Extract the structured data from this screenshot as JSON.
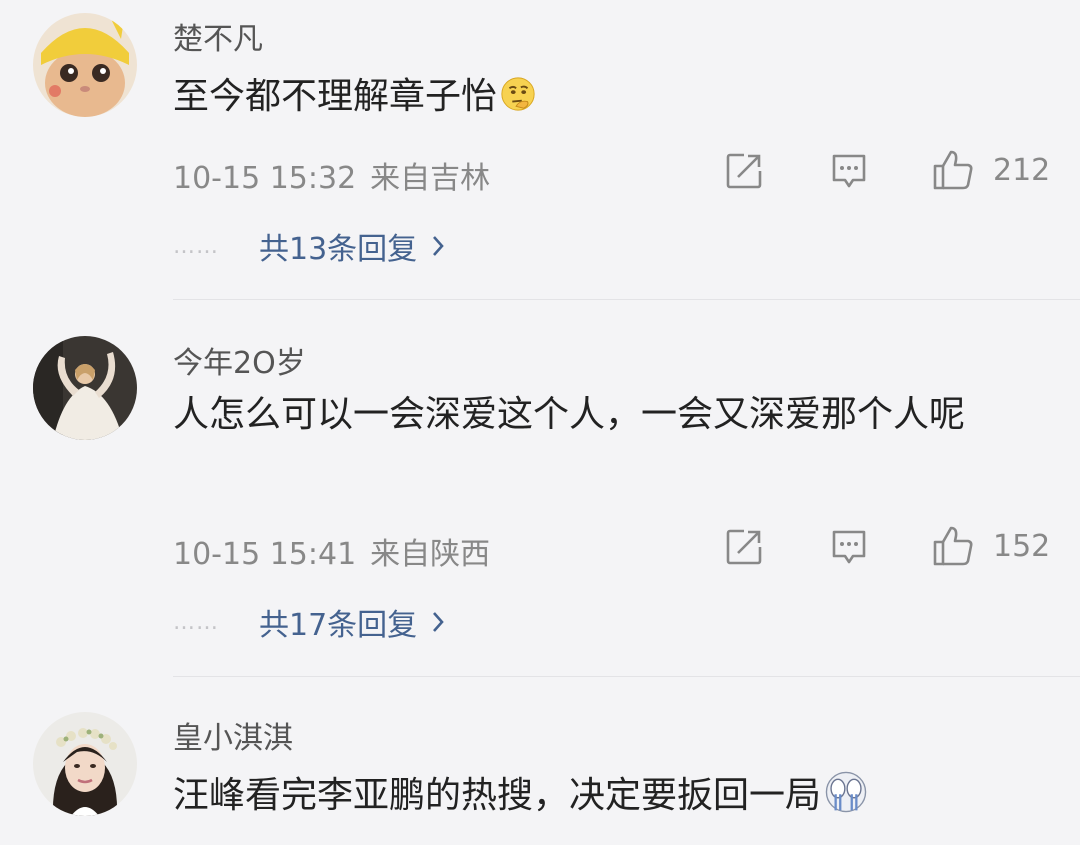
{
  "comments": [
    {
      "username": "楚不凡",
      "text": "至今都不理解章子怡",
      "emoji": "thinking-face-emoji",
      "time": "10-15 15:32",
      "location": "来自吉林",
      "likes": "212",
      "replies_label": "共13条回复",
      "avatar": "avatar-cat-pikachu-hat"
    },
    {
      "username": "今年2O岁",
      "text": "人怎么可以一会深爱这个人，一会又深爱那个人呢",
      "time": "10-15 15:41",
      "location": "来自陕西",
      "likes": "152",
      "replies_label": "共17条回复",
      "avatar": "avatar-woman-white-dress"
    },
    {
      "username": "皇小淇淇",
      "text": "汪峰看完李亚鹏的热搜，决定要扳回一局",
      "emoji": "crying-face-emoji",
      "avatar": "avatar-woman-flower-crown"
    }
  ],
  "more_dots": "……",
  "icons": {
    "share": "share-icon",
    "comment": "comment-icon",
    "like": "thumbs-up-icon",
    "chevron": "chevron-right-icon"
  },
  "colors": {
    "background": "#f4f4f6",
    "username": "#555555",
    "meta": "#888888",
    "reply_link": "#44628f",
    "text": "#222222"
  }
}
